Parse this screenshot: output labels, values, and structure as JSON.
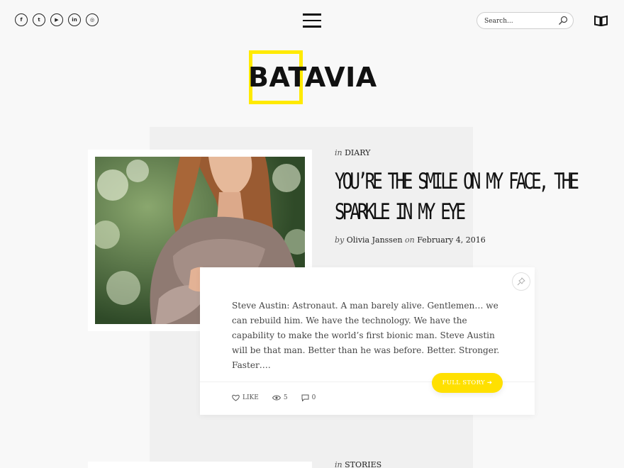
{
  "header": {
    "social": [
      {
        "name": "facebook-icon",
        "glyph": "f"
      },
      {
        "name": "twitter-icon",
        "glyph": "t"
      },
      {
        "name": "youtube-icon",
        "glyph": "▶"
      },
      {
        "name": "linkedin-icon",
        "glyph": "in"
      },
      {
        "name": "instagram-icon",
        "glyph": "◎"
      }
    ],
    "search_placeholder": "Search...",
    "logo": "BATAVIA",
    "accent_color": "#ffea00"
  },
  "post1": {
    "category_prefix": "in",
    "category": "DIARY",
    "title_line1": "YOU’RE THE SMILE ON MY FACE, THE",
    "title_line2": "SPARKLE IN MY EYE",
    "by_prefix": "by",
    "author": "Olivia Janssen",
    "on_prefix": "on",
    "date": "February 4, 2016",
    "excerpt": "Steve Austin: Astronaut. A man barely alive. Gentlemen… we can rebuild him. We have the technology. We have the capability to make the world’s first bionic man. Steve Austin will be that man. Better than he was before. Better. Stronger. Faster….",
    "like_label": "LIKE",
    "views": "5",
    "comments": "0",
    "full_story_label": "FULL STORY ➔"
  },
  "post2": {
    "category_prefix": "in",
    "category": "STORIES"
  }
}
